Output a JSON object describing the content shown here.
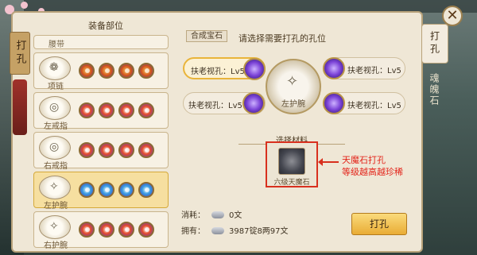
{
  "left_tab": "打孔",
  "list_title": "装备部位",
  "partial_item": "腰带",
  "slots": [
    {
      "name": "项链",
      "gems": [
        "orange",
        "orange",
        "orange",
        "orange"
      ]
    },
    {
      "name": "左戒指",
      "gems": [
        "red",
        "red",
        "red",
        "red"
      ]
    },
    {
      "name": "右戒指",
      "gems": [
        "red",
        "red",
        "red",
        "red"
      ]
    },
    {
      "name": "左护腕",
      "gems": [
        "blue",
        "blue",
        "blue",
        "blue"
      ]
    },
    {
      "name": "右护腕",
      "gems": [
        "red",
        "red",
        "red",
        "red"
      ]
    }
  ],
  "compose_tab": "合成宝石",
  "instruction": "请选择需要打孔的孔位",
  "holes": [
    {
      "label": "扶老视孔：Lv5"
    },
    {
      "label": "扶老视孔：Lv5"
    },
    {
      "label": "扶老视孔：Lv5"
    },
    {
      "label": "扶老视孔：Lv5"
    }
  ],
  "center_item": "左护腕",
  "material_title": "选择材料",
  "material_label": "六级天魔石",
  "annotation": [
    "天魔石打孔",
    "等级越高越珍稀"
  ],
  "cost": {
    "label": "消耗：",
    "value": "0文"
  },
  "own": {
    "label": "拥有：",
    "value": "3987锭8两97文"
  },
  "dig_button": "打孔",
  "right_tabs": {
    "dig": "打孔",
    "soul_stone": "魂魄石"
  }
}
